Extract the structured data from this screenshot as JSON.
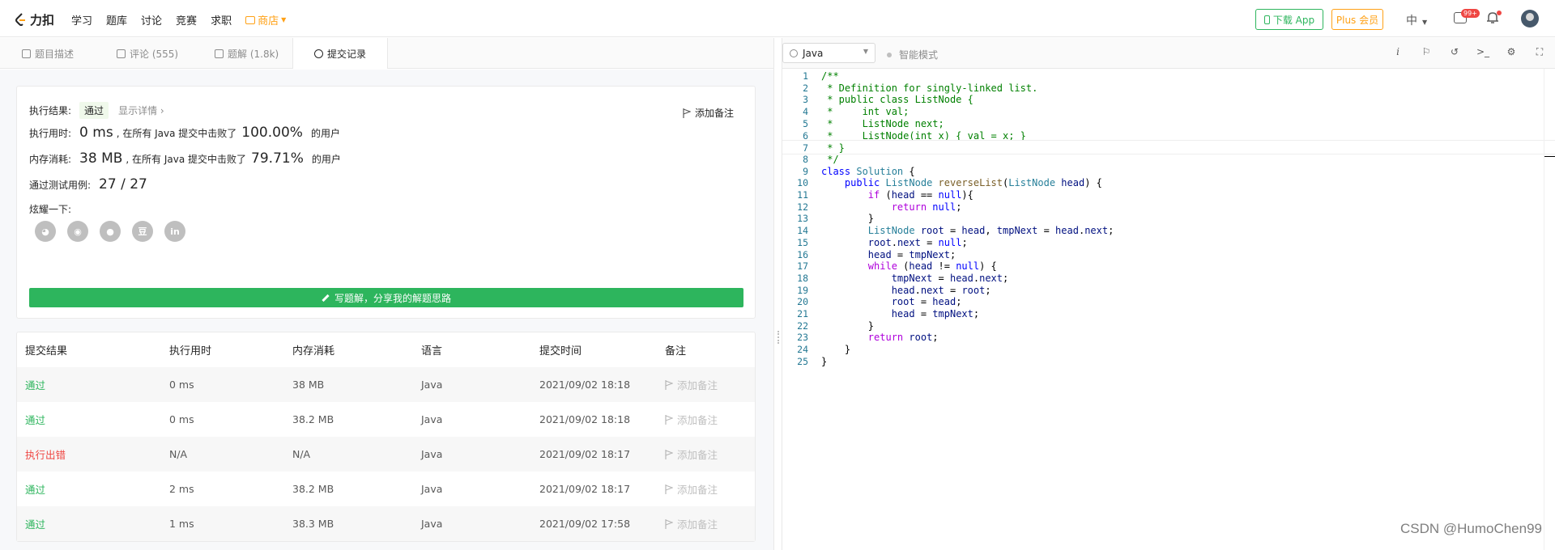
{
  "nav": {
    "logo_text": "力扣",
    "links": [
      "学习",
      "题库",
      "讨论",
      "竞赛",
      "求职"
    ],
    "shop_label": "商店",
    "download_label": "下载 App",
    "plus_label": "Plus 会员",
    "lang_label": "中",
    "badge_count": "99+"
  },
  "tabs": [
    {
      "label": "题目描述",
      "icon": "document-icon"
    },
    {
      "label": "评论 (555)",
      "icon": "comment-icon"
    },
    {
      "label": "题解 (1.8k)",
      "icon": "flask-icon"
    },
    {
      "label": "提交记录",
      "icon": "clock-icon"
    }
  ],
  "result": {
    "status_label": "执行结果:",
    "status_value": "通过",
    "detail_link": "显示详情 ›",
    "add_note": "添加备注",
    "runtime_label": "执行用时:",
    "runtime_value": "0 ms",
    "runtime_text": ", 在所有 Java 提交中击败了",
    "runtime_pct": "100.00%",
    "runtime_suffix": "的用户",
    "memory_label": "内存消耗:",
    "memory_value": "38 MB",
    "memory_text": ", 在所有 Java 提交中击败了",
    "memory_pct": "79.71%",
    "memory_suffix": "的用户",
    "tests_label": "通过测试用例:",
    "tests_value": "27 / 27",
    "share_label": "炫耀一下:",
    "share_icons": [
      "wechat-icon",
      "weibo-icon",
      "qq-icon",
      "douban-icon",
      "linkedin-icon"
    ],
    "write_solution": "写题解，分享我的解题思路"
  },
  "table": {
    "headers": [
      "提交结果",
      "执行用时",
      "内存消耗",
      "语言",
      "提交时间",
      "备注"
    ],
    "rows": [
      {
        "result": "通过",
        "status": "ok",
        "time": "0 ms",
        "memory": "38 MB",
        "lang": "Java",
        "date": "2021/09/02 18:18",
        "note": "添加备注"
      },
      {
        "result": "通过",
        "status": "ok",
        "time": "0 ms",
        "memory": "38.2 MB",
        "lang": "Java",
        "date": "2021/09/02 18:18",
        "note": "添加备注"
      },
      {
        "result": "执行出错",
        "status": "err",
        "time": "N/A",
        "memory": "N/A",
        "lang": "Java",
        "date": "2021/09/02 18:17",
        "note": "添加备注"
      },
      {
        "result": "通过",
        "status": "ok",
        "time": "2 ms",
        "memory": "38.2 MB",
        "lang": "Java",
        "date": "2021/09/02 18:17",
        "note": "添加备注"
      },
      {
        "result": "通过",
        "status": "ok",
        "time": "1 ms",
        "memory": "38.3 MB",
        "lang": "Java",
        "date": "2021/09/02 17:58",
        "note": "添加备注"
      }
    ]
  },
  "editor": {
    "language": "Java",
    "smart_mode": "智能模式",
    "tools": [
      "info-icon",
      "flag-icon",
      "reset-icon",
      "terminal-icon",
      "settings-icon",
      "fullscreen-icon"
    ],
    "current_line": 7,
    "code": [
      [
        [
          "cm",
          "/**"
        ]
      ],
      [
        [
          "cm",
          " * Definition for singly-linked list."
        ]
      ],
      [
        [
          "cm",
          " * public class ListNode {"
        ]
      ],
      [
        [
          "cm",
          " *     int val;"
        ]
      ],
      [
        [
          "cm",
          " *     ListNode next;"
        ]
      ],
      [
        [
          "cm",
          " *     ListNode(int x) { val = x; }"
        ]
      ],
      [
        [
          "cm",
          " * }"
        ]
      ],
      [
        [
          "cm",
          " */"
        ]
      ],
      [
        [
          "kw2",
          "class"
        ],
        [
          "",
          " "
        ],
        [
          "ty",
          "Solution"
        ],
        [
          "",
          " {"
        ]
      ],
      [
        [
          "",
          "    "
        ],
        [
          "kw2",
          "public"
        ],
        [
          "",
          " "
        ],
        [
          "ty",
          "ListNode"
        ],
        [
          "",
          " "
        ],
        [
          "fn",
          "reverseList"
        ],
        [
          "",
          "("
        ],
        [
          "ty",
          "ListNode"
        ],
        [
          "",
          " "
        ],
        [
          "vr",
          "head"
        ],
        [
          "",
          ") {"
        ]
      ],
      [
        [
          "",
          "        "
        ],
        [
          "kw",
          "if"
        ],
        [
          "",
          " ("
        ],
        [
          "vr",
          "head"
        ],
        [
          "",
          " == "
        ],
        [
          "kw2",
          "null"
        ],
        [
          "",
          "){"
        ]
      ],
      [
        [
          "",
          "            "
        ],
        [
          "kw",
          "return"
        ],
        [
          "",
          " "
        ],
        [
          "kw2",
          "null"
        ],
        [
          "",
          ";"
        ]
      ],
      [
        [
          "",
          "        }"
        ]
      ],
      [
        [
          "",
          "        "
        ],
        [
          "ty",
          "ListNode"
        ],
        [
          "",
          " "
        ],
        [
          "vr",
          "root"
        ],
        [
          "",
          " = "
        ],
        [
          "vr",
          "head"
        ],
        [
          "",
          ", "
        ],
        [
          "vr",
          "tmpNext"
        ],
        [
          "",
          " = "
        ],
        [
          "vr",
          "head"
        ],
        [
          "",
          "."
        ],
        [
          "vr",
          "next"
        ],
        [
          "",
          ";"
        ]
      ],
      [
        [
          "",
          "        "
        ],
        [
          "vr",
          "root"
        ],
        [
          "",
          "."
        ],
        [
          "vr",
          "next"
        ],
        [
          "",
          " = "
        ],
        [
          "kw2",
          "null"
        ],
        [
          "",
          ";"
        ]
      ],
      [
        [
          "",
          "        "
        ],
        [
          "vr",
          "head"
        ],
        [
          "",
          " = "
        ],
        [
          "vr",
          "tmpNext"
        ],
        [
          "",
          ";"
        ]
      ],
      [
        [
          "",
          "        "
        ],
        [
          "kw",
          "while"
        ],
        [
          "",
          " ("
        ],
        [
          "vr",
          "head"
        ],
        [
          "",
          " != "
        ],
        [
          "kw2",
          "null"
        ],
        [
          "",
          ") {"
        ]
      ],
      [
        [
          "",
          "            "
        ],
        [
          "vr",
          "tmpNext"
        ],
        [
          "",
          " = "
        ],
        [
          "vr",
          "head"
        ],
        [
          "",
          "."
        ],
        [
          "vr",
          "next"
        ],
        [
          "",
          ";"
        ]
      ],
      [
        [
          "",
          "            "
        ],
        [
          "vr",
          "head"
        ],
        [
          "",
          "."
        ],
        [
          "vr",
          "next"
        ],
        [
          "",
          " = "
        ],
        [
          "vr",
          "root"
        ],
        [
          "",
          ";"
        ]
      ],
      [
        [
          "",
          "            "
        ],
        [
          "vr",
          "root"
        ],
        [
          "",
          " = "
        ],
        [
          "vr",
          "head"
        ],
        [
          "",
          ";"
        ]
      ],
      [
        [
          "",
          "            "
        ],
        [
          "vr",
          "head"
        ],
        [
          "",
          " = "
        ],
        [
          "vr",
          "tmpNext"
        ],
        [
          "",
          ";"
        ]
      ],
      [
        [
          "",
          "        }"
        ]
      ],
      [
        [
          "",
          "        "
        ],
        [
          "kw",
          "return"
        ],
        [
          "",
          " "
        ],
        [
          "vr",
          "root"
        ],
        [
          "",
          ";"
        ]
      ],
      [
        [
          "",
          "    }"
        ]
      ],
      [
        [
          "",
          "}"
        ]
      ]
    ]
  },
  "watermark": "CSDN @HumoChen99"
}
